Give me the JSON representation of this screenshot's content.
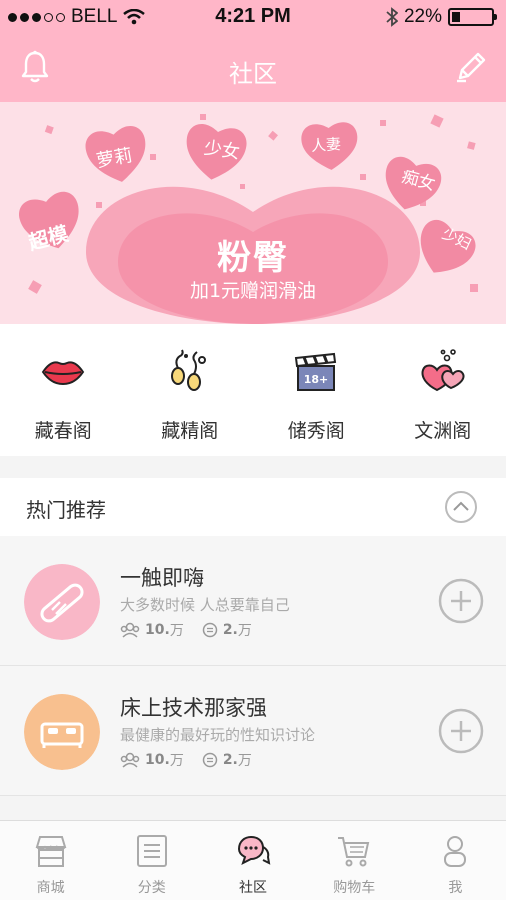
{
  "status_bar": {
    "carrier": "BELL",
    "time": "4:21 PM",
    "battery_percent": "22%",
    "battery_level": 0.22
  },
  "header": {
    "title": "社区",
    "left_icon": "bell-icon",
    "right_icon": "pencil-icon"
  },
  "banner": {
    "title": "粉臀",
    "subtitle": "加1元赠润滑油",
    "hearts": [
      "超模",
      "萝莉",
      "少女",
      "人妻",
      "痴女",
      "少妇"
    ]
  },
  "categories": [
    {
      "label": "藏春阁",
      "icon": "lips-icon"
    },
    {
      "label": "藏精阁",
      "icon": "sperm-icon"
    },
    {
      "label": "储秀阁",
      "icon": "clapperboard-18-icon"
    },
    {
      "label": "文渊阁",
      "icon": "hearts-icon"
    }
  ],
  "section": {
    "title": "热门推荐"
  },
  "topics": [
    {
      "title": "一触即嗨",
      "desc": "大多数时候 人总要靠自己",
      "members": "10.",
      "members_unit": "万",
      "posts": "2.",
      "posts_unit": "万",
      "color": "#f9b7c7"
    },
    {
      "title": "床上技术那家强",
      "desc": "最健康的最好玩的性知识讨论",
      "members": "10.",
      "members_unit": "万",
      "posts": "2.",
      "posts_unit": "万",
      "color": "#f8c08f"
    }
  ],
  "tabbar": [
    {
      "label": "商城",
      "icon": "shop-icon"
    },
    {
      "label": "分类",
      "icon": "list-icon"
    },
    {
      "label": "社区",
      "icon": "chat-icon",
      "active": true
    },
    {
      "label": "购物车",
      "icon": "cart-icon"
    },
    {
      "label": "我",
      "icon": "person-icon"
    }
  ],
  "colors": {
    "accent": "#ffb6c8",
    "banner_bg": "#fde0e7",
    "heart": "#f4839f"
  }
}
